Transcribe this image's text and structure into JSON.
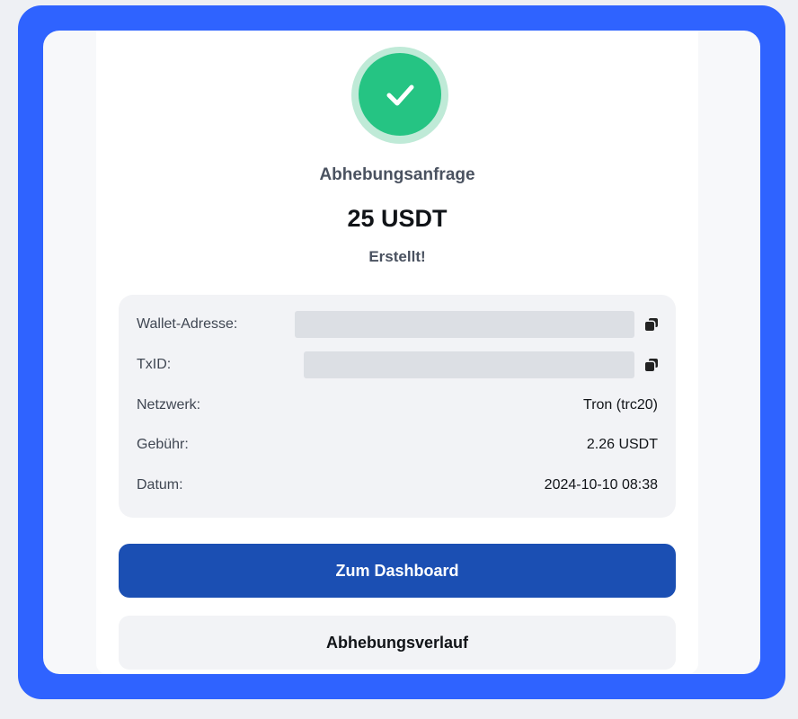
{
  "colors": {
    "frame": "#2f63ff",
    "success": "#25c483",
    "primary_button": "#1b4fb3"
  },
  "result": {
    "icon": "check-icon",
    "title": "Abhebungsanfrage",
    "amount": "25 USDT",
    "status": "Erstellt!"
  },
  "details": {
    "wallet": {
      "label": "Wallet-Adresse:",
      "value_state": "redacted",
      "copy_icon": "copy-icon"
    },
    "txid": {
      "label": "TxID:",
      "value_state": "redacted",
      "copy_icon": "copy-icon"
    },
    "network": {
      "label": "Netzwerk:",
      "value": "Tron (trc20)"
    },
    "fee": {
      "label": "Gebühr:",
      "value": "2.26 USDT"
    },
    "date": {
      "label": "Datum:",
      "value": "2024-10-10 08:38"
    }
  },
  "actions": {
    "dashboard": "Zum Dashboard",
    "history": "Abhebungsverlauf"
  }
}
